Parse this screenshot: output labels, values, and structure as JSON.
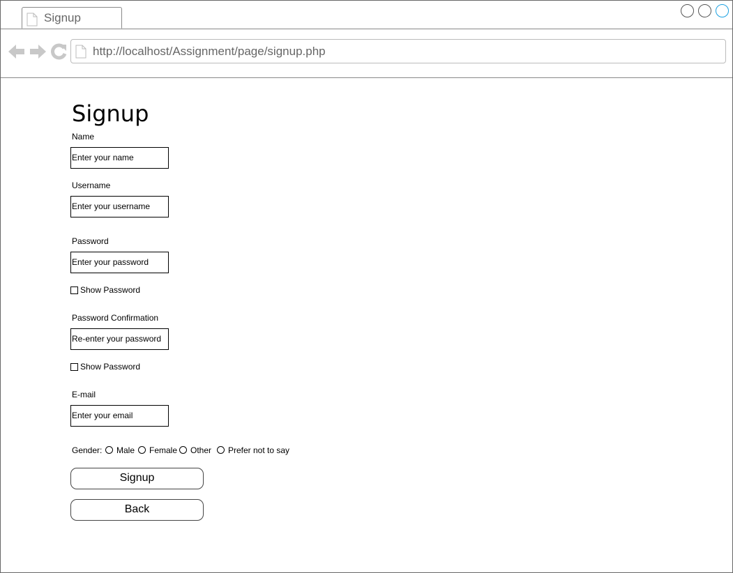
{
  "browser": {
    "tab_title": "Signup",
    "url": "http://localhost/Assignment/page/signup.php"
  },
  "form": {
    "title": "Signup",
    "name_label": "Name",
    "name_placeholder": "Enter your name",
    "username_label": "Username",
    "username_placeholder": "Enter your username",
    "password_label": "Password",
    "password_placeholder": "Enter your password",
    "show_password_label": "Show Password",
    "confirm_label": "Password Confirmation",
    "confirm_placeholder": "Re-enter your password",
    "show_password_label_2": "Show Password",
    "email_label": "E-mail",
    "email_placeholder": "Enter your email",
    "gender_label": "Gender:",
    "gender_options": [
      "Male",
      "Female",
      "Other",
      "Prefer not to say"
    ],
    "signup_button": "Signup",
    "back_button": "Back"
  },
  "icons": {
    "tab": "document-icon",
    "url": "document-icon",
    "back": "arrow-left-icon",
    "forward": "arrow-right-icon",
    "reload": "reload-icon"
  },
  "colors": {
    "accent": "#1ba1e2",
    "nav_icon": "#c8c8c8",
    "muted_text": "#666666"
  }
}
